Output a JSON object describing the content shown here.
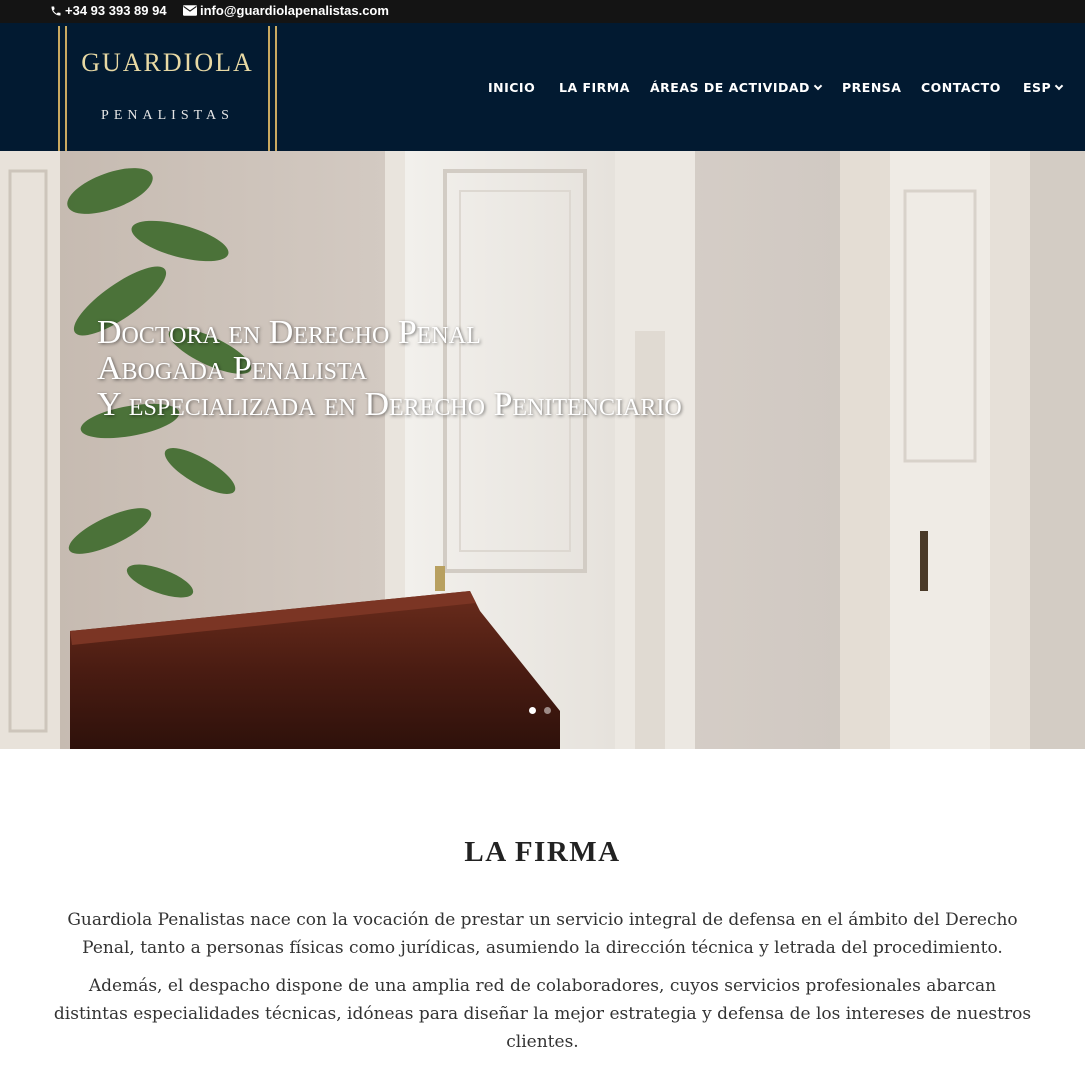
{
  "topbar": {
    "phone": "+34 93 393 89 94",
    "email": "info@guardiolapenalistas.com",
    "phone_icon": "phone-icon",
    "email_icon": "envelope-icon"
  },
  "logo": {
    "name": "GUARDIOLA",
    "sub": "PENALISTAS"
  },
  "nav": {
    "items": [
      {
        "label": "INICIO"
      },
      {
        "label": "LA FIRMA"
      },
      {
        "label": "ÁREAS DE ACTIVIDAD",
        "dropdown": true
      },
      {
        "label": "PRENSA"
      },
      {
        "label": "CONTACTO"
      },
      {
        "label": "ESP",
        "dropdown": true
      }
    ]
  },
  "hero": {
    "lines": [
      "Doctora en Derecho Penal",
      "Abogada Penalista",
      "Y especializada en Derecho Penitenciario"
    ],
    "slides": 2,
    "active_slide": 1
  },
  "section": {
    "title": "LA FIRMA",
    "paragraphs": [
      "Guardiola Penalistas nace con la vocación de prestar un servicio integral de defensa en el ámbito del Derecho Penal, tanto a personas físicas como jurídicas, asumiendo la dirección técnica y letrada del procedimiento.",
      "Además, el despacho dispone de una amplia red de colaboradores, cuyos servicios profesionales abarcan distintas especialidades técnicas, idóneas para diseñar la mejor estrategia y defensa de los intereses de nuestros clientes."
    ]
  },
  "colors": {
    "topbar": "#141414",
    "header": "#021a31",
    "gold": "#c9a961"
  }
}
